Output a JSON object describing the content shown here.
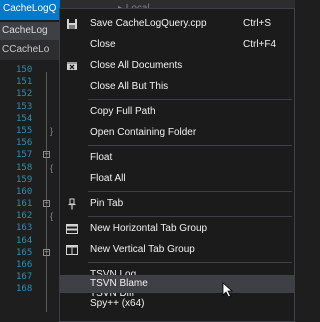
{
  "editor": {
    "active_tab": "CacheLogQ",
    "faint_tab": "▸ Local",
    "file_tabs": [
      "CacheLog",
      "CCacheLo"
    ],
    "line_numbers": [
      "150",
      "151",
      "152",
      "153",
      "154",
      "155",
      "156",
      "157",
      "158",
      "159",
      "160",
      "161",
      "162",
      "163",
      "164",
      "165",
      "166",
      "167",
      "168"
    ]
  },
  "menu": {
    "items": [
      {
        "label": "Save CacheLogQuery.cpp",
        "shortcut": "Ctrl+S",
        "icon": "save-icon"
      },
      {
        "label": "Close",
        "shortcut": "Ctrl+F4",
        "icon": ""
      },
      {
        "label": "Close All Documents",
        "shortcut": "",
        "icon": "close-all-icon"
      },
      {
        "label": "Close All But This",
        "shortcut": "",
        "icon": ""
      },
      {
        "label": "Copy Full Path",
        "shortcut": "",
        "icon": ""
      },
      {
        "label": "Open Containing Folder",
        "shortcut": "",
        "icon": ""
      },
      {
        "label": "Float",
        "shortcut": "",
        "icon": ""
      },
      {
        "label": "Float All",
        "shortcut": "",
        "icon": ""
      },
      {
        "label": "Pin Tab",
        "shortcut": "",
        "icon": "pin-icon"
      },
      {
        "label": "New Horizontal Tab Group",
        "shortcut": "",
        "icon": "horizontal-tab-group-icon"
      },
      {
        "label": "New Vertical Tab Group",
        "shortcut": "",
        "icon": "vertical-tab-group-icon"
      },
      {
        "label": "TSVN Log",
        "shortcut": "",
        "icon": ""
      },
      {
        "label": "TSVN Diff",
        "shortcut": "",
        "icon": ""
      },
      {
        "label": "TSVN Blame",
        "shortcut": "",
        "icon": "",
        "highlighted": true
      },
      {
        "label": "Spy++ (x64)",
        "shortcut": "",
        "icon": ""
      }
    ]
  },
  "colors": {
    "accent": "#007acc",
    "menu_bg": "#1b1b1c",
    "highlight": "#3f3f46",
    "line_number": "#2b91af"
  }
}
